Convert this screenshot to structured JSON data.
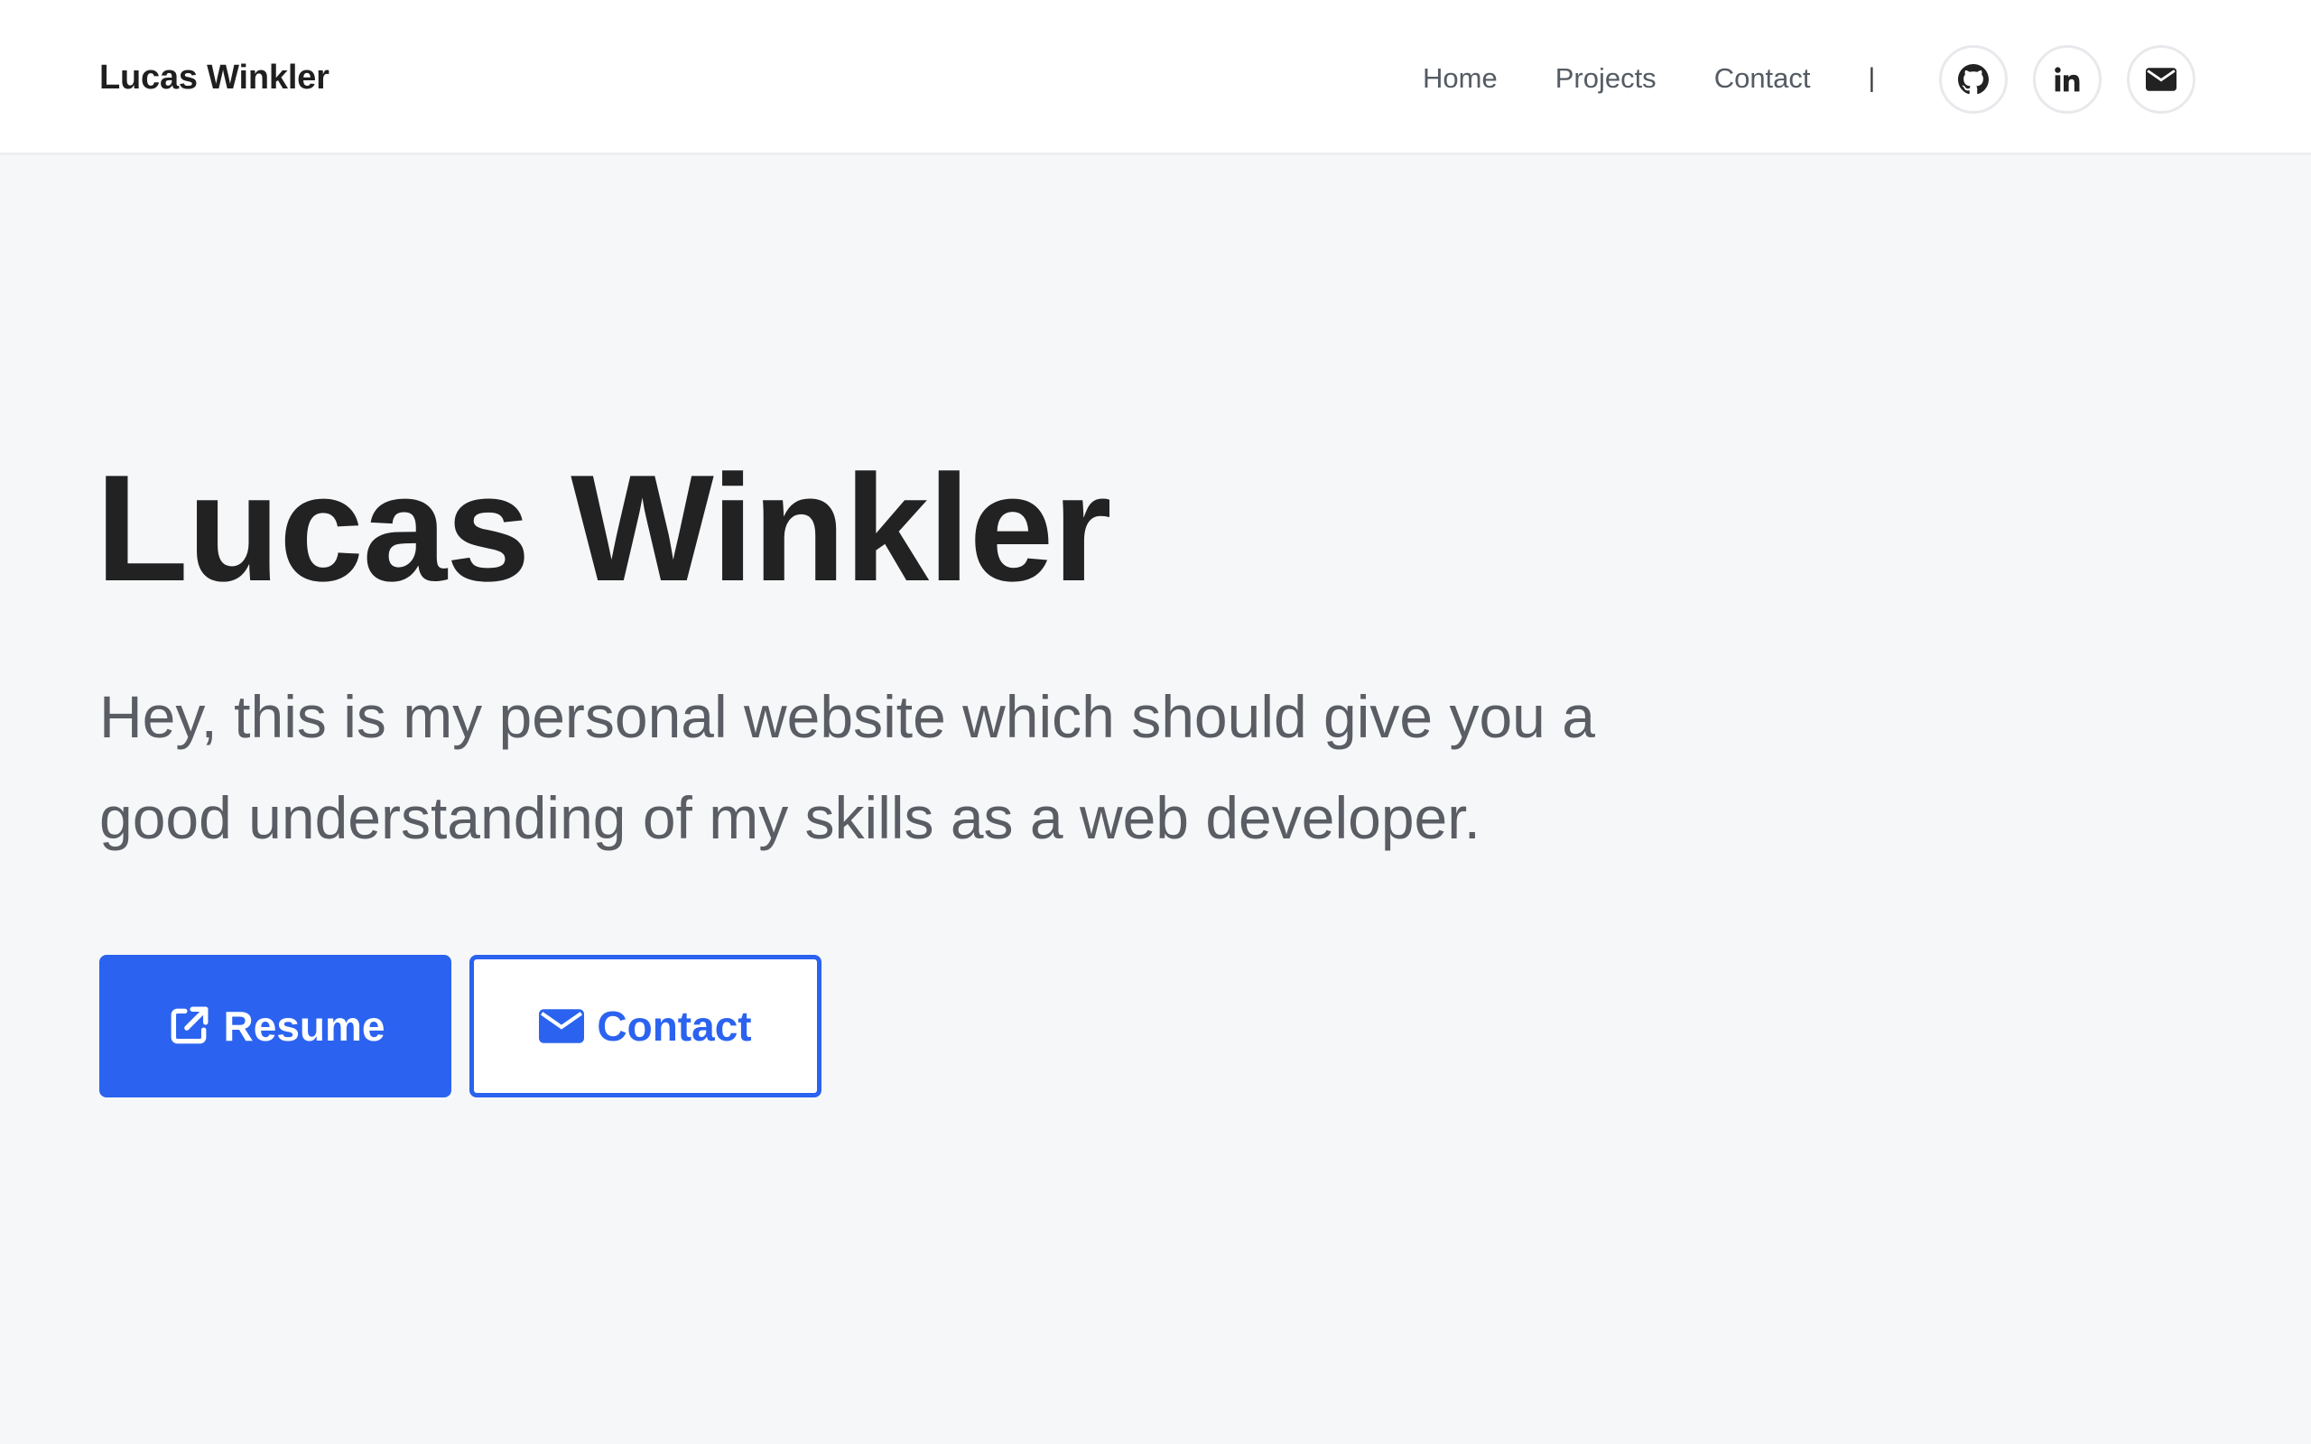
{
  "header": {
    "brand": "Lucas Winkler",
    "nav": [
      {
        "label": "Home"
      },
      {
        "label": "Projects"
      },
      {
        "label": "Contact"
      }
    ],
    "separator": "|",
    "social": [
      {
        "icon": "github-icon"
      },
      {
        "icon": "linkedin-icon"
      },
      {
        "icon": "envelope-icon"
      }
    ]
  },
  "hero": {
    "title": "Lucas Winkler",
    "text": "Hey, this is my personal website which should give you a good understanding of my skills as a web developer.",
    "buttons": {
      "resume_label": "Resume",
      "resume_icon": "external-link-icon",
      "contact_label": "Contact",
      "contact_icon": "envelope-icon"
    }
  },
  "colors": {
    "accent": "#2b63f0",
    "background": "#f6f7f9",
    "navbar": "#ffffff",
    "heading": "#222222",
    "body_text": "#5a5d63"
  }
}
